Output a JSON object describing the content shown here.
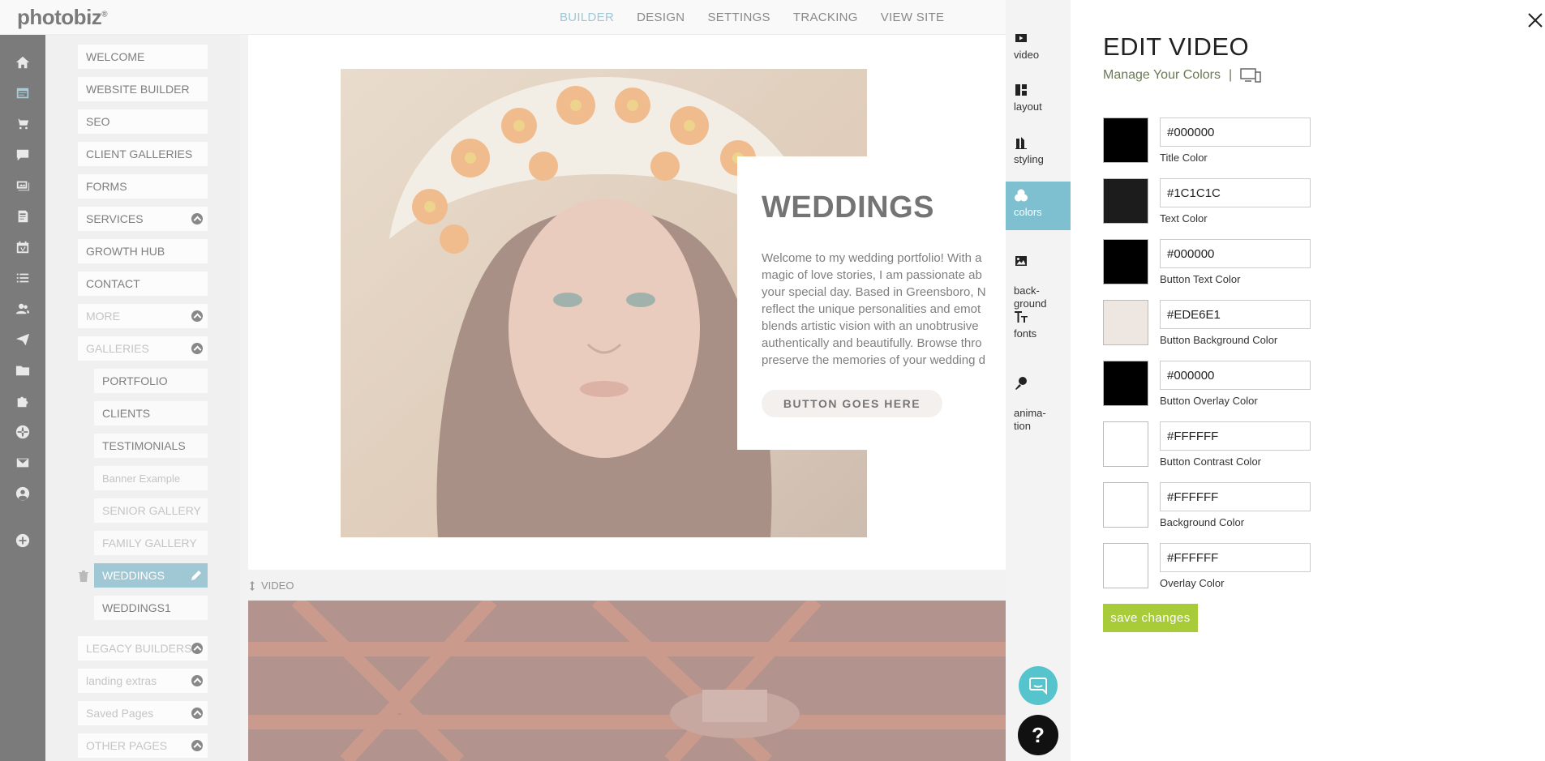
{
  "topbar": {
    "logo": "photobiz",
    "nav": [
      "BUILDER",
      "DESIGN",
      "SETTINGS",
      "TRACKING",
      "VIEW SITE"
    ]
  },
  "pagelist": {
    "items": [
      {
        "label": "WELCOME"
      },
      {
        "label": "WEBSITE BUILDER"
      },
      {
        "label": "SEO"
      },
      {
        "label": "CLIENT GALLERIES"
      },
      {
        "label": "FORMS"
      },
      {
        "label": "SERVICES"
      },
      {
        "label": "GROWTH HUB"
      },
      {
        "label": "CONTACT"
      },
      {
        "label": "MORE"
      },
      {
        "label": "GALLERIES"
      },
      {
        "label": "PORTFOLIO"
      },
      {
        "label": "CLIENTS"
      },
      {
        "label": "TESTIMONIALS"
      },
      {
        "label": "Banner Example"
      },
      {
        "label": "SENIOR GALLERY"
      },
      {
        "label": "FAMILY GALLERY"
      },
      {
        "label": "WEDDINGS"
      },
      {
        "label": "WEDDINGS1"
      },
      {
        "label": "LEGACY BUILDERS"
      },
      {
        "label": "landing extras"
      },
      {
        "label": "Saved Pages"
      },
      {
        "label": "OTHER PAGES"
      }
    ]
  },
  "canvas": {
    "title": "WEDDINGS",
    "body": "Welcome to my wedding portfolio! With a\nmagic of love stories, I am passionate ab\nyour special day. Based in Greensboro, N\nreflect the unique personalities and emot\nblends artistic vision with an unobtrusive\nauthentically and beautifully. Browse thro\npreserve the memories of your wedding d",
    "button": "BUTTON GOES HERE",
    "video_label": "VIDEO"
  },
  "editor_tabs": [
    {
      "label": "video",
      "icon": "video-icon"
    },
    {
      "label": "layout",
      "icon": "layout-icon"
    },
    {
      "label": "styling",
      "icon": "styling-icon"
    },
    {
      "label": "colors",
      "icon": "colors-icon"
    },
    {
      "label": "back-\nground",
      "icon": "image-icon"
    },
    {
      "label": "fonts",
      "icon": "fonts-icon"
    },
    {
      "label": "anima-\ntion",
      "icon": "animation-icon"
    }
  ],
  "panel": {
    "title": "EDIT VIDEO",
    "manage": "Manage Your Colors",
    "separator": "|",
    "save": "save changes",
    "colors": [
      {
        "hex": "#000000",
        "label": "Title Color"
      },
      {
        "hex": "#1C1C1C",
        "label": "Text Color"
      },
      {
        "hex": "#000000",
        "label": "Button Text Color"
      },
      {
        "hex": "#EDE6E1",
        "label": "Button Background Color"
      },
      {
        "hex": "#000000",
        "label": "Button Overlay Color"
      },
      {
        "hex": "#FFFFFF",
        "label": "Button Contrast Color"
      },
      {
        "hex": "#FFFFFF",
        "label": "Background Color"
      },
      {
        "hex": "#FFFFFF",
        "label": "Overlay Color"
      }
    ]
  },
  "help": "?"
}
